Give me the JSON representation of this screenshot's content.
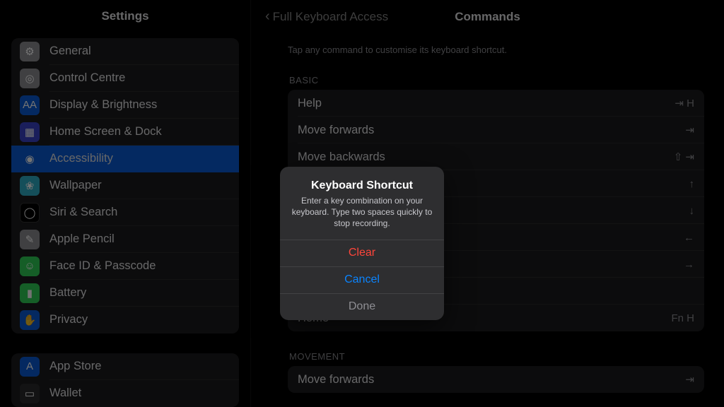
{
  "sidebar": {
    "title": "Settings",
    "group1": [
      {
        "label": "General",
        "icon": "⚙",
        "bg": "bg-grey",
        "name": "general"
      },
      {
        "label": "Control Centre",
        "icon": "◎",
        "bg": "bg-grey",
        "name": "control-centre"
      },
      {
        "label": "Display & Brightness",
        "icon": "AA",
        "bg": "bg-blue",
        "name": "display-brightness"
      },
      {
        "label": "Home Screen & Dock",
        "icon": "▦",
        "bg": "bg-indigo",
        "name": "home-screen-dock"
      },
      {
        "label": "Accessibility",
        "icon": "◉",
        "bg": "bg-blue",
        "name": "accessibility",
        "selected": true
      },
      {
        "label": "Wallpaper",
        "icon": "❀",
        "bg": "bg-teal",
        "name": "wallpaper"
      },
      {
        "label": "Siri & Search",
        "icon": "◯",
        "bg": "bg-black",
        "name": "siri-search"
      },
      {
        "label": "Apple Pencil",
        "icon": "✎",
        "bg": "bg-grey",
        "name": "apple-pencil"
      },
      {
        "label": "Face ID & Passcode",
        "icon": "☺",
        "bg": "bg-green",
        "name": "faceid-passcode"
      },
      {
        "label": "Battery",
        "icon": "▮",
        "bg": "bg-green",
        "name": "battery"
      },
      {
        "label": "Privacy",
        "icon": "✋",
        "bg": "bg-blue",
        "name": "privacy"
      }
    ],
    "group2": [
      {
        "label": "App Store",
        "icon": "A",
        "bg": "bg-blue",
        "name": "app-store"
      },
      {
        "label": "Wallet",
        "icon": "▭",
        "bg": "bg-orange",
        "name": "wallet"
      }
    ]
  },
  "header": {
    "back": "Full Keyboard Access",
    "title": "Commands"
  },
  "hint": "Tap any command to customise its keyboard shortcut.",
  "sections": {
    "basic": {
      "title": "BASIC",
      "rows": [
        {
          "label": "Help",
          "shortcut": "⇥ H"
        },
        {
          "label": "Move forwards",
          "shortcut": "⇥"
        },
        {
          "label": "Move backwards",
          "shortcut": "⇧ ⇥"
        },
        {
          "label": "",
          "shortcut": "↑"
        },
        {
          "label": "",
          "shortcut": "↓"
        },
        {
          "label": "",
          "shortcut": "←"
        },
        {
          "label": "",
          "shortcut": "→"
        },
        {
          "label": "",
          "shortcut": ""
        },
        {
          "label": "Home",
          "shortcut": "Fn H"
        }
      ]
    },
    "movement": {
      "title": "MOVEMENT",
      "rows": [
        {
          "label": "Move forwards",
          "shortcut": "⇥"
        }
      ]
    }
  },
  "modal": {
    "title": "Keyboard Shortcut",
    "message": "Enter a key combination on your keyboard. Type two spaces quickly to stop recording.",
    "clear": "Clear",
    "cancel": "Cancel",
    "done": "Done"
  }
}
